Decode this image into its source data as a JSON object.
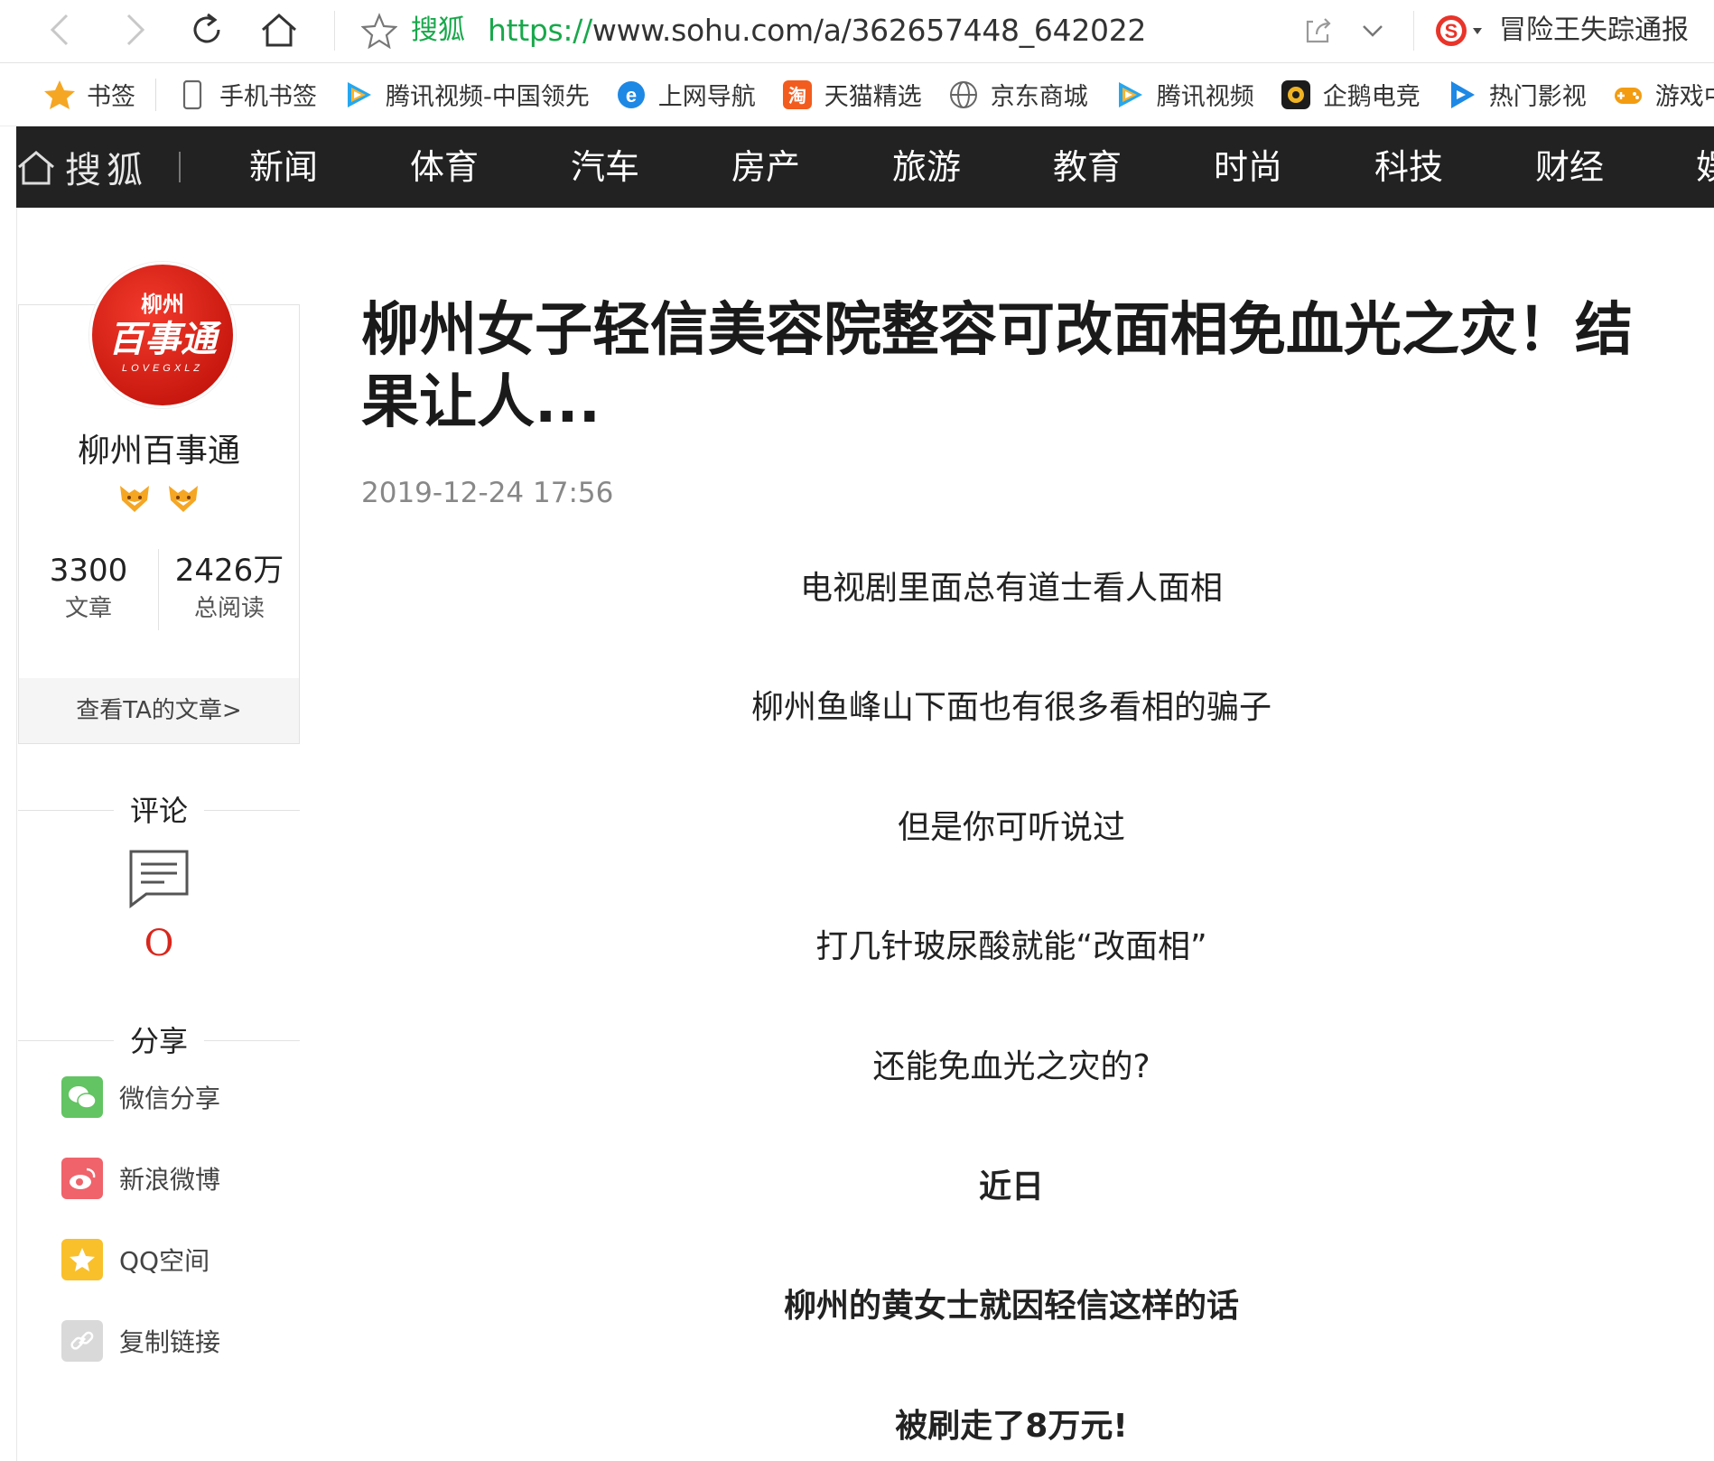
{
  "browser": {
    "site_name": "搜狐",
    "url_scheme": "https://",
    "url_rest": "www.sohu.com/a/362657448_642022",
    "search_hint": "冒险王失踪通报"
  },
  "bookmarks": [
    {
      "label": "书签",
      "icon": "star-icon"
    },
    {
      "label": "手机书签",
      "icon": "phone-icon"
    },
    {
      "label": "腾讯视频-中国领先",
      "icon": "tencent-video-icon"
    },
    {
      "label": "上网导航",
      "icon": "ie-icon"
    },
    {
      "label": "天猫精选",
      "icon": "tmall-icon"
    },
    {
      "label": "京东商城",
      "icon": "globe-icon"
    },
    {
      "label": "腾讯视频",
      "icon": "tencent-video-icon"
    },
    {
      "label": "企鹅电竞",
      "icon": "penguin-esports-icon"
    },
    {
      "label": "热门影视",
      "icon": "play-icon"
    },
    {
      "label": "游戏中",
      "icon": "gamepad-icon"
    }
  ],
  "site": {
    "logo_text": "搜狐",
    "nav": [
      "新闻",
      "体育",
      "汽车",
      "房产",
      "旅游",
      "教育",
      "时尚",
      "科技",
      "财经",
      "娱"
    ]
  },
  "author": {
    "avatar_top": "柳州",
    "avatar_main": "百事通",
    "avatar_sub": "LOVEGXLZ",
    "name": "柳州百事通",
    "articles_count": "3300",
    "articles_label": "文章",
    "reads_count": "2426万",
    "reads_label": "总阅读",
    "view_articles": "查看TA的文章>"
  },
  "comments": {
    "heading": "评论",
    "count": "O"
  },
  "share": {
    "heading": "分享",
    "items": [
      {
        "label": "微信分享",
        "color": "#62c462"
      },
      {
        "label": "新浪微博",
        "color": "#f0636b"
      },
      {
        "label": "QQ空间",
        "color": "#f9c02c"
      },
      {
        "label": "复制链接",
        "color": "#d9d9d9"
      }
    ]
  },
  "article": {
    "title": "柳州女子轻信美容院整容可改面相免血光之灾！结果让人...",
    "date": "2019-12-24 17:56",
    "paragraphs": [
      {
        "text": "电视剧里面总有道士看人面相",
        "bold": false
      },
      {
        "text": "柳州鱼峰山下面也有很多看相的骗子",
        "bold": false
      },
      {
        "text": "但是你可听说过",
        "bold": false
      },
      {
        "text": "打几针玻尿酸就能“改面相”",
        "bold": false
      },
      {
        "text": "还能免血光之灾的?",
        "bold": false
      },
      {
        "text": "近日",
        "bold": true
      },
      {
        "text": "柳州的黄女士就因轻信这样的话",
        "bold": true
      },
      {
        "text": "被刷走了8万元!",
        "bold": true
      }
    ]
  }
}
